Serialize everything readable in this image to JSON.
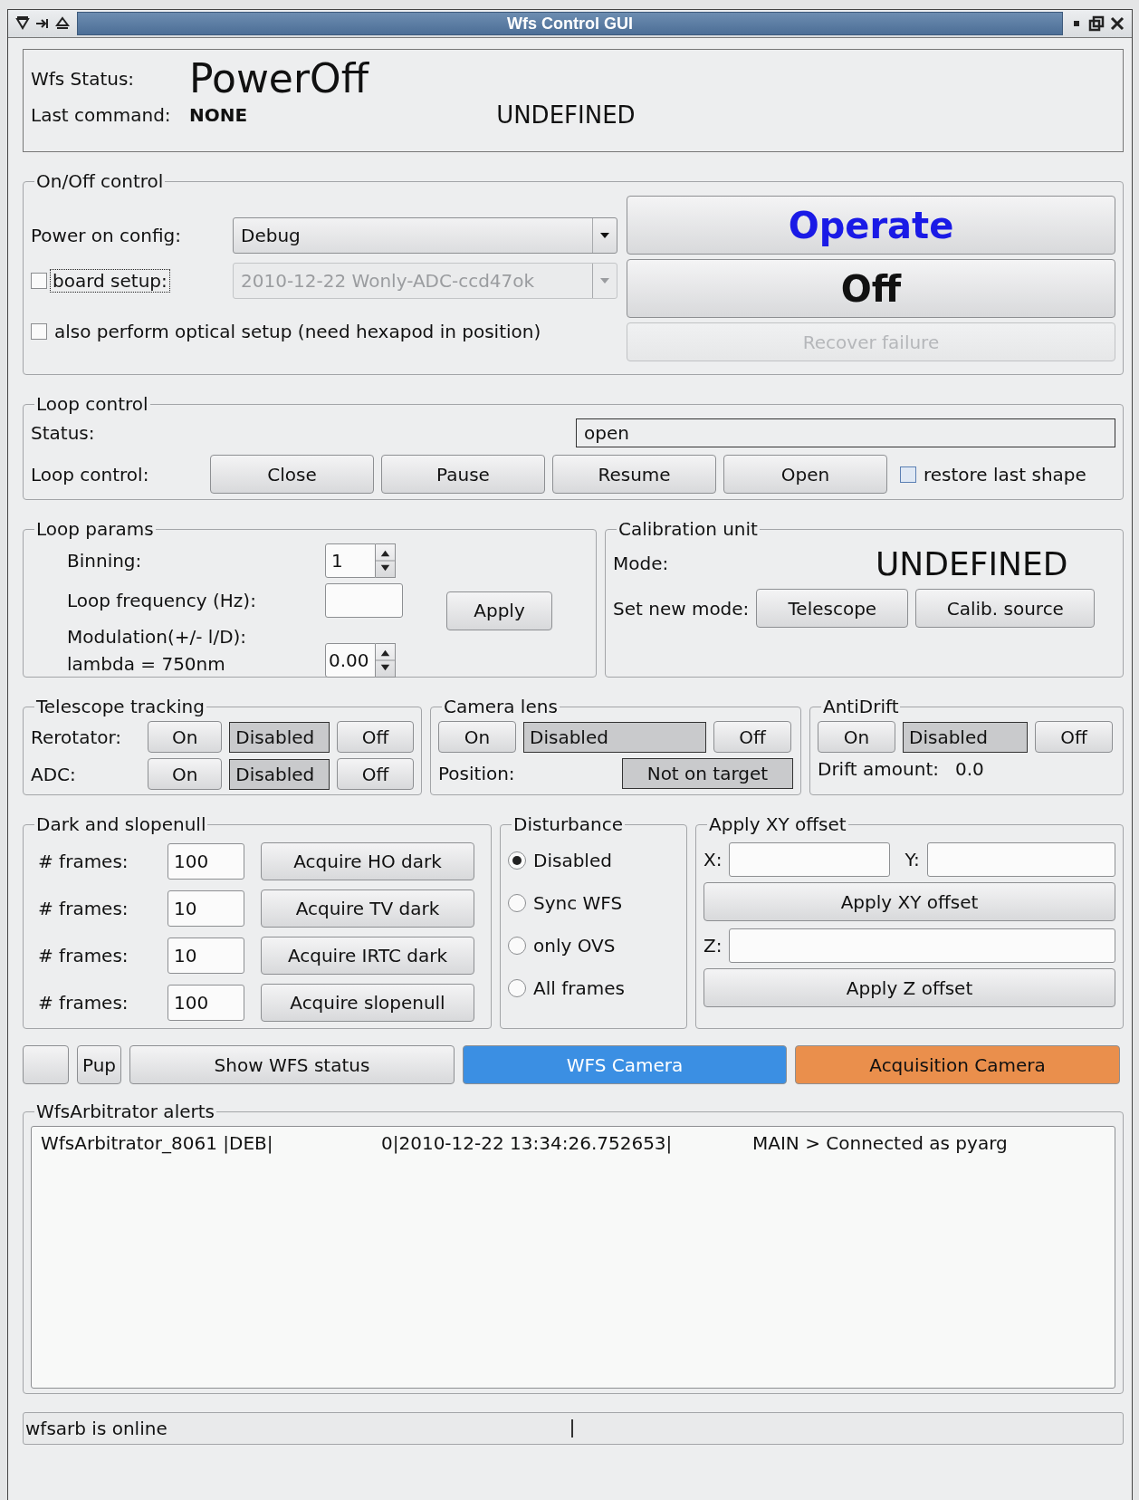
{
  "window": {
    "title": "Wfs Control GUI"
  },
  "status": {
    "label": "Wfs Status:",
    "value": "PowerOff",
    "last_command_label": "Last command:",
    "last_command": "NONE",
    "mode": "UNDEFINED"
  },
  "onoff": {
    "title": "On/Off control",
    "power_config": {
      "label": "Power on config:",
      "value": "Debug",
      "disabled": false
    },
    "board_setup": {
      "label": "board setup:",
      "checked": false,
      "value": "2010-12-22 Wonly-ADC-ccd47ok",
      "disabled": true
    },
    "optical_setup": {
      "label": "also perform optical setup (need hexapod in position)",
      "checked": false
    },
    "buttons": [
      {
        "label": "Operate",
        "kind": "link",
        "disabled": false
      },
      {
        "label": "Off",
        "kind": "big",
        "disabled": false
      },
      {
        "label": "Recover failure",
        "kind": "normal",
        "disabled": true
      }
    ]
  },
  "loop_control": {
    "title": "Loop control",
    "status_label": "Status:",
    "status": "open",
    "control_label": "Loop control:",
    "buttons": [
      {
        "label": "Close"
      },
      {
        "label": "Pause"
      },
      {
        "label": "Resume"
      },
      {
        "label": "Open"
      }
    ],
    "restore": {
      "label": "restore last shape",
      "checked": false
    }
  },
  "loop_params": {
    "title": "Loop params",
    "binning_label": "Binning:",
    "binning": "1",
    "frequency_label": "Loop frequency (Hz):",
    "modulation_label": "Modulation(+/- l/D):",
    "lambda_label": "lambda = 750nm",
    "modulation": "0.00",
    "apply": {
      "label": "Apply"
    }
  },
  "calibration": {
    "title": "Calibration unit",
    "mode_label": "Mode:",
    "mode": "UNDEFINED",
    "set_label": "Set new mode:",
    "buttons": [
      {
        "label": "Telescope"
      },
      {
        "label": "Calib. source"
      }
    ]
  },
  "tracking": {
    "title": "Telescope tracking",
    "rows": [
      {
        "label": "Rerotator:",
        "on": {
          "label": "On"
        },
        "status": "Disabled",
        "off": {
          "label": "Off"
        }
      },
      {
        "label": "ADC:",
        "on": {
          "label": "On"
        },
        "status": "Disabled",
        "off": {
          "label": "Off"
        }
      }
    ]
  },
  "camera_lens": {
    "title": "Camera lens",
    "on": {
      "label": "On"
    },
    "status": "Disabled",
    "off": {
      "label": "Off"
    },
    "position_label": "Position:",
    "position": "Not on target"
  },
  "antidrift": {
    "title": "AntiDrift",
    "on": {
      "label": "On"
    },
    "status": "Disabled",
    "off": {
      "label": "Off"
    },
    "drift_label": "Drift amount:",
    "drift": "0.0"
  },
  "dark": {
    "title": "Dark and slopenull",
    "rows": [
      {
        "label": "# frames:",
        "value": "100",
        "button": {
          "label": "Acquire HO dark"
        }
      },
      {
        "label": "# frames:",
        "value": "10",
        "button": {
          "label": "Acquire TV dark"
        }
      },
      {
        "label": "# frames:",
        "value": "10",
        "button": {
          "label": "Acquire IRTC dark"
        }
      },
      {
        "label": "# frames:",
        "value": "100",
        "button": {
          "label": "Acquire slopenull"
        }
      }
    ]
  },
  "disturbance": {
    "title": "Disturbance",
    "options": [
      {
        "label": "Disabled",
        "selected": true
      },
      {
        "label": "Sync WFS",
        "selected": false
      },
      {
        "label": "only OVS",
        "selected": false
      },
      {
        "label": "All frames",
        "selected": false
      }
    ]
  },
  "xy_offset": {
    "title": "Apply XY offset",
    "x_label": "X:",
    "y_label": "Y:",
    "apply_xy": {
      "label": "Apply XY offset"
    },
    "z_label": "Z:",
    "apply_z": {
      "label": "Apply Z offset"
    }
  },
  "bottom_buttons": [
    {
      "kind": "blank"
    },
    {
      "kind": "text",
      "label": "Pup"
    },
    {
      "kind": "text",
      "label": "Show WFS status"
    },
    {
      "kind": "text",
      "label": "WFS Camera",
      "color": "#3b8fe3"
    },
    {
      "kind": "text",
      "label": "Acquisition Camera",
      "color": "#ea8f4c"
    }
  ],
  "alerts": {
    "title": "WfsArbitrator alerts",
    "lines": [
      {
        "source": "WfsArbitrator_8061 |DEB|",
        "time": "0|2010-12-22 13:34:26.752653|",
        "message": "MAIN > Connected as pyarg"
      }
    ]
  },
  "status_bar": {
    "message": "wfsarb is online"
  }
}
